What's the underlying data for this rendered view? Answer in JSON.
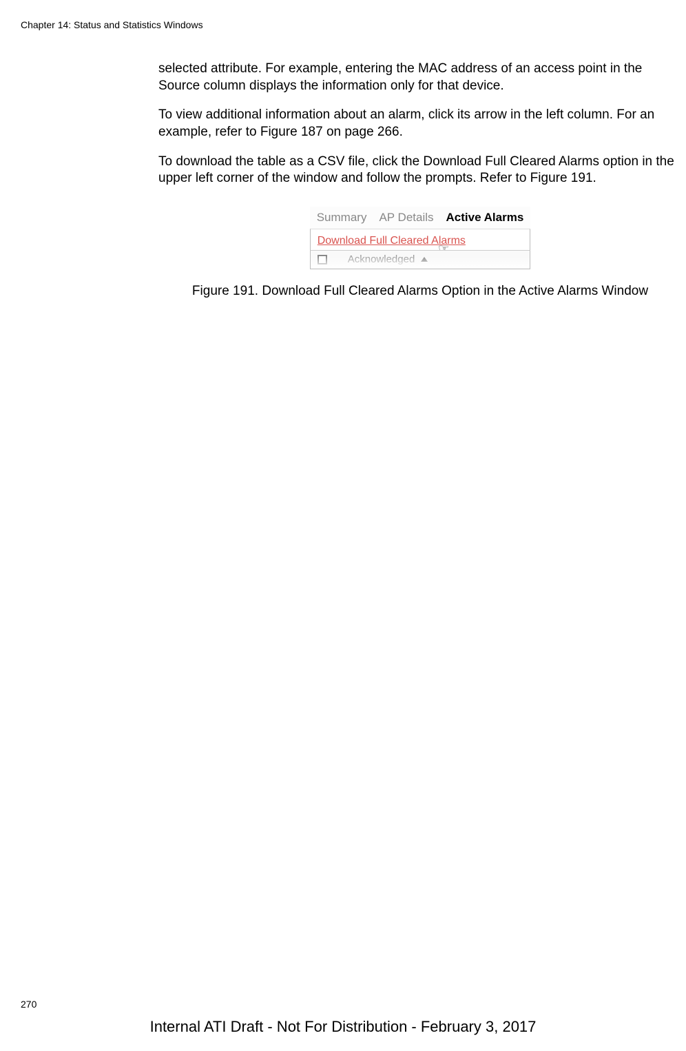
{
  "header": {
    "chapter_title": "Chapter 14: Status and Statistics Windows"
  },
  "body": {
    "paragraph1": "selected attribute. For example, entering the MAC address of an access point in the Source column displays the information only for that device.",
    "paragraph2": "To view additional information about an alarm, click its arrow in the left column. For an example, refer to Figure 187 on page 266.",
    "paragraph3": "To download the table as a CSV file, click the Download Full Cleared Alarms option in the upper left corner of the window and follow the prompts. Refer to Figure 191."
  },
  "figure": {
    "tabs": {
      "summary": "Summary",
      "ap_details": "AP Details",
      "active_alarms": "Active Alarms"
    },
    "download_link": "Download Full Cleared Alarms",
    "column_header": "Acknowledged",
    "caption": "Figure 191. Download Full Cleared Alarms Option in the Active Alarms Window"
  },
  "footer": {
    "page_number": "270",
    "draft_notice": "Internal ATI Draft - Not For Distribution - February 3, 2017"
  }
}
